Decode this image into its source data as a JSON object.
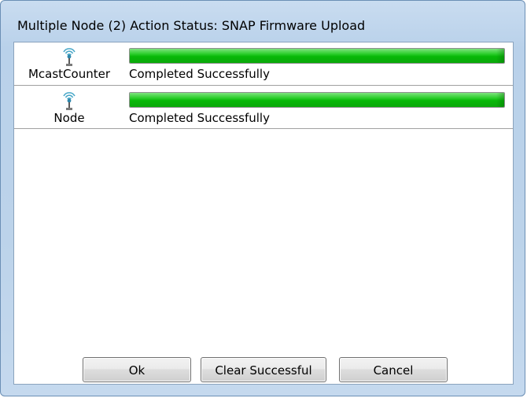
{
  "window": {
    "title": "Multiple Node (2) Action Status: SNAP Firmware Upload"
  },
  "nodes": [
    {
      "name": "McastCounter",
      "icon": "wireless-node-icon",
      "progress": 1.0,
      "status": "Completed Successfully"
    },
    {
      "name": "Node",
      "icon": "wireless-node-icon",
      "progress": 1.0,
      "status": "Completed Successfully"
    }
  ],
  "buttons": {
    "ok": "Ok",
    "clear_successful": "Clear Successful",
    "cancel": "Cancel"
  },
  "colors": {
    "progress_fill": "#18c018",
    "titlebar": "#bcd3ea"
  }
}
